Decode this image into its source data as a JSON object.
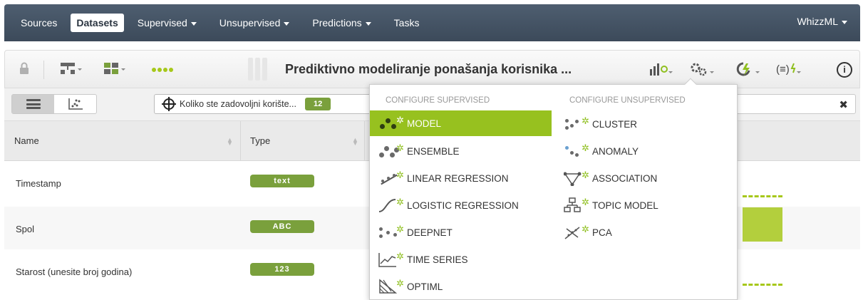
{
  "nav": {
    "items": [
      {
        "label": "Sources",
        "caret": false,
        "active": false
      },
      {
        "label": "Datasets",
        "caret": false,
        "active": true
      },
      {
        "label": "Supervised",
        "caret": true,
        "active": false
      },
      {
        "label": "Unsupervised",
        "caret": true,
        "active": false
      },
      {
        "label": "Predictions",
        "caret": true,
        "active": false
      },
      {
        "label": "Tasks",
        "caret": false,
        "active": false
      }
    ],
    "right_label": "WhizzML"
  },
  "toolbar": {
    "title": "Prediktivno modeliranje ponašanja korisnika ...",
    "info_glyph": "i"
  },
  "filter": {
    "objective_label": "Koliko ste zadovoljni korište...",
    "objective_badge": "12",
    "clear_glyph": "✖"
  },
  "table": {
    "headers": {
      "name": "Name",
      "type": "Type"
    },
    "rows": [
      {
        "name": "Timestamp",
        "type": "text"
      },
      {
        "name": "Spol",
        "type": "ABC"
      },
      {
        "name": "Starost (unesite broj godina)",
        "type": "123"
      }
    ]
  },
  "dropdown": {
    "supervised_heading": "CONFIGURE SUPERVISED",
    "unsupervised_heading": "CONFIGURE UNSUPERVISED",
    "supervised": [
      {
        "label": "MODEL",
        "icon": "model-icon",
        "active": true
      },
      {
        "label": "ENSEMBLE",
        "icon": "ensemble-icon",
        "active": false
      },
      {
        "label": "LINEAR REGRESSION",
        "icon": "linear-regression-icon",
        "active": false
      },
      {
        "label": "LOGISTIC REGRESSION",
        "icon": "logistic-regression-icon",
        "active": false
      },
      {
        "label": "DEEPNET",
        "icon": "deepnet-icon",
        "active": false
      },
      {
        "label": "TIME SERIES",
        "icon": "time-series-icon",
        "active": false
      },
      {
        "label": "OPTIML",
        "icon": "optiml-icon",
        "active": false
      }
    ],
    "unsupervised": [
      {
        "label": "CLUSTER",
        "icon": "cluster-icon"
      },
      {
        "label": "ANOMALY",
        "icon": "anomaly-icon"
      },
      {
        "label": "ASSOCIATION",
        "icon": "association-icon"
      },
      {
        "label": "TOPIC MODEL",
        "icon": "topic-model-icon"
      },
      {
        "label": "PCA",
        "icon": "pca-icon"
      }
    ]
  },
  "colors": {
    "nav_bg": "#46566a",
    "accent_green": "#97c11f",
    "badge_green": "#7aa03c"
  }
}
